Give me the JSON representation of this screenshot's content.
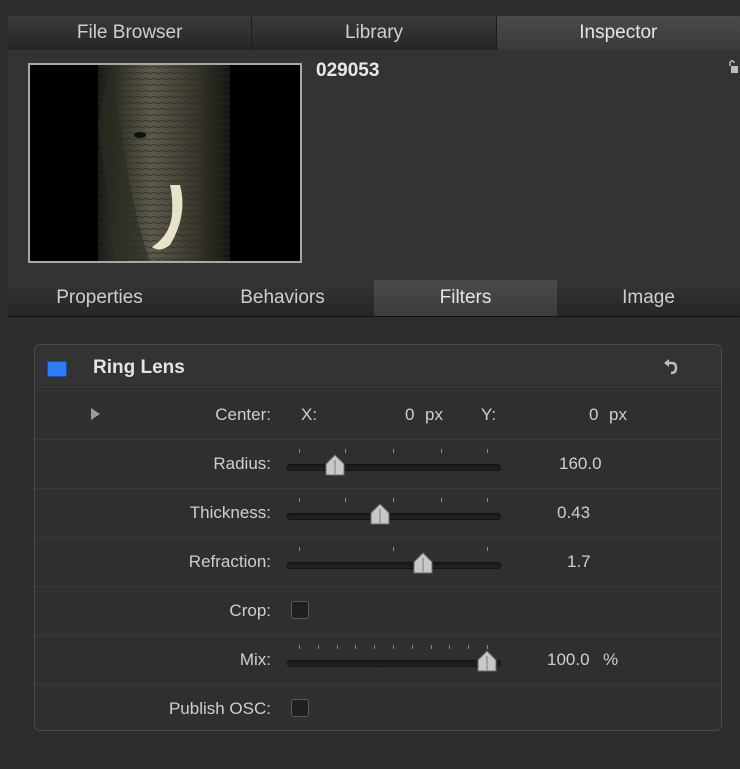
{
  "tabs": {
    "top": [
      {
        "label": "File Browser",
        "active": false
      },
      {
        "label": "Library",
        "active": false
      },
      {
        "label": "Inspector",
        "active": true
      }
    ],
    "sub": [
      {
        "label": "Properties",
        "active": false
      },
      {
        "label": "Behaviors",
        "active": false
      },
      {
        "label": "Filters",
        "active": true
      },
      {
        "label": "Image",
        "active": false
      }
    ]
  },
  "preview": {
    "clip_name": "029053",
    "thumbnail_icon": "elephant-photo",
    "lock_icon": "unlocked-lock-icon"
  },
  "filter": {
    "name": "Ring Lens",
    "enabled": true,
    "accent_color": "#2f7cf6",
    "reset_icon": "reset-arrow-icon",
    "center": {
      "label": "Center:",
      "x_label": "X:",
      "x_value": "0",
      "x_unit": "px",
      "y_label": "Y:",
      "y_value": "0",
      "y_unit": "px"
    },
    "radius": {
      "label": "Radius:",
      "value": "160.0",
      "slider_fraction": 0.19
    },
    "thickness": {
      "label": "Thickness:",
      "value": "0.43",
      "slider_fraction": 0.43
    },
    "refraction": {
      "label": "Refraction:",
      "value": "1.7",
      "slider_fraction": 0.66
    },
    "crop": {
      "label": "Crop:",
      "checked": false
    },
    "mix": {
      "label": "Mix:",
      "value": "100.0",
      "unit": "%",
      "slider_fraction": 1.0
    },
    "publish_osc": {
      "label": "Publish OSC:",
      "checked": false
    }
  }
}
